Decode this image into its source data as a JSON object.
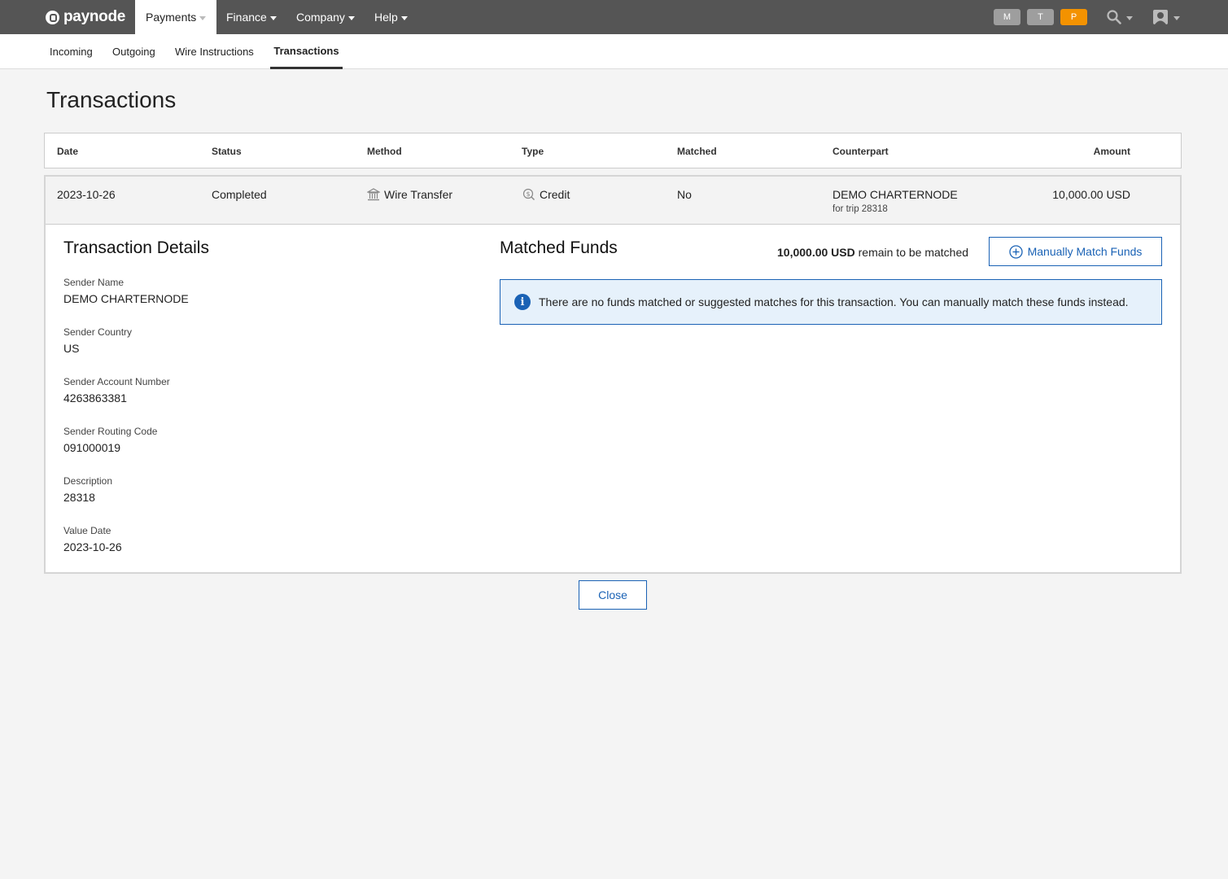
{
  "topnav": {
    "brand": "paynode",
    "items": [
      {
        "label": "Payments"
      },
      {
        "label": "Finance"
      },
      {
        "label": "Company"
      },
      {
        "label": "Help"
      }
    ],
    "badges": [
      {
        "label": "M",
        "color": "#9e9e9e"
      },
      {
        "label": "T",
        "color": "#9e9e9e"
      },
      {
        "label": "P",
        "color": "#f39200"
      }
    ]
  },
  "subnav": {
    "tabs": [
      {
        "label": "Incoming"
      },
      {
        "label": "Outgoing"
      },
      {
        "label": "Wire Instructions"
      },
      {
        "label": "Transactions"
      }
    ]
  },
  "page": {
    "title": "Transactions"
  },
  "table": {
    "headers": {
      "date": "Date",
      "status": "Status",
      "method": "Method",
      "type": "Type",
      "matched": "Matched",
      "counterpart": "Counterpart",
      "amount": "Amount"
    },
    "row": {
      "date": "2023-10-26",
      "status": "Completed",
      "method": "Wire Transfer",
      "method_icon": "bank-icon",
      "type": "Credit",
      "type_icon": "coin-search-icon",
      "matched": "No",
      "counterpart": "DEMO CHARTERNODE",
      "counterpart_note": "for trip 28318",
      "amount": "10,000.00 USD"
    }
  },
  "details": {
    "title": "Transaction Details",
    "fields": [
      {
        "label": "Sender Name",
        "value": "DEMO CHARTERNODE"
      },
      {
        "label": "Sender Country",
        "value": "US"
      },
      {
        "label": "Sender Account Number",
        "value": "4263863381"
      },
      {
        "label": "Sender Routing Code",
        "value": "091000019"
      },
      {
        "label": "Description",
        "value": "28318"
      },
      {
        "label": "Value Date",
        "value": "2023-10-26"
      }
    ]
  },
  "matched_funds": {
    "title": "Matched Funds",
    "remain_amount": "10,000.00 USD",
    "remain_text": "remain to be matched",
    "match_button": "Manually Match Funds",
    "info": "There are no funds matched or suggested matches for this transaction. You can manually match these funds instead."
  },
  "close_button": "Close",
  "colors": {
    "accent": "#1a62b5",
    "nav_bg": "#555555",
    "info_bg": "#e6f1fb"
  }
}
